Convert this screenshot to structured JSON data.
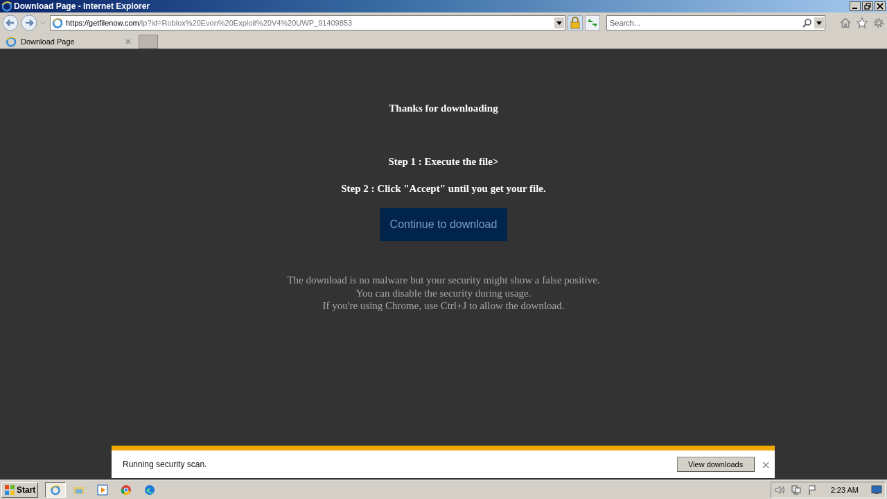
{
  "window": {
    "title": "Download Page - Internet Explorer"
  },
  "address_bar": {
    "url_host": "https://getfilenow.com",
    "url_path": "/lp?id=Roblox%20Evon%20Exploit%20V4%20UWP_91409853"
  },
  "search": {
    "placeholder": "Search..."
  },
  "tabs": [
    {
      "label": "Download Page",
      "selected": true
    }
  ],
  "page": {
    "title": "Thanks for downloading",
    "steps": [
      "Step 1 : Execute the file>",
      "Step 2 : Click \"Accept\" until you get your file."
    ],
    "button": "Continue to download",
    "notes": [
      "The download is no malware but your security might show a false positive.",
      "You can disable the security during usage.",
      "If you're using Chrome, use Ctrl+J to allow the download."
    ]
  },
  "download_bar": {
    "message": "Running security scan.",
    "button": "View downloads",
    "close": "×"
  },
  "taskbar": {
    "start": "Start",
    "apps": [
      {
        "kind": "ie",
        "selected": true
      },
      {
        "kind": "folder",
        "selected": false
      },
      {
        "kind": "media",
        "selected": false
      },
      {
        "kind": "chrome",
        "selected": false
      },
      {
        "kind": "edge",
        "selected": false
      }
    ],
    "clock": "2:23 AM"
  }
}
